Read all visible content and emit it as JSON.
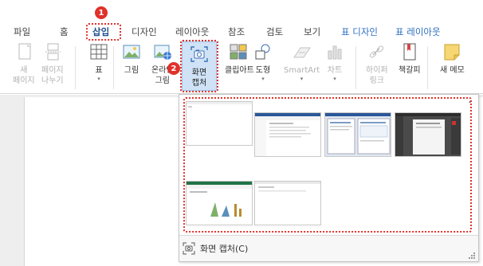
{
  "tabs": [
    {
      "label": "파일",
      "contextual": false,
      "active": false
    },
    {
      "label": "홈",
      "contextual": false,
      "active": false
    },
    {
      "label": "삽입",
      "contextual": false,
      "active": true
    },
    {
      "label": "디자인",
      "contextual": false,
      "active": false
    },
    {
      "label": "레이아웃",
      "contextual": false,
      "active": false
    },
    {
      "label": "참조",
      "contextual": false,
      "active": false
    },
    {
      "label": "검토",
      "contextual": false,
      "active": false
    },
    {
      "label": "보기",
      "contextual": false,
      "active": false
    },
    {
      "label": "표 디자인",
      "contextual": true,
      "active": false
    },
    {
      "label": "표 레이아웃",
      "contextual": true,
      "active": false
    }
  ],
  "ribbon": {
    "new_page": "새\n페이지",
    "page_break": "페이지\n나누기",
    "table": "표",
    "picture": "그림",
    "online_picture": "온라인\n그림",
    "screenshot": "화면\n캡처",
    "smartart_clip": "클립아트",
    "shapes": "도형",
    "smartart": "SmartArt",
    "chart": "차트",
    "hyperlink": "하이퍼\n링크",
    "bookmark": "책갈피",
    "new_memo": "새 메모"
  },
  "callouts": [
    "1",
    "2"
  ],
  "gallery": {
    "footer_label": "화면 캡처(C)"
  },
  "colors": {
    "callout": "#e0312b",
    "active_tab": "#1f4e8c",
    "contextual_tab": "#2e6fc0",
    "highlight": "#cfe2f6"
  }
}
